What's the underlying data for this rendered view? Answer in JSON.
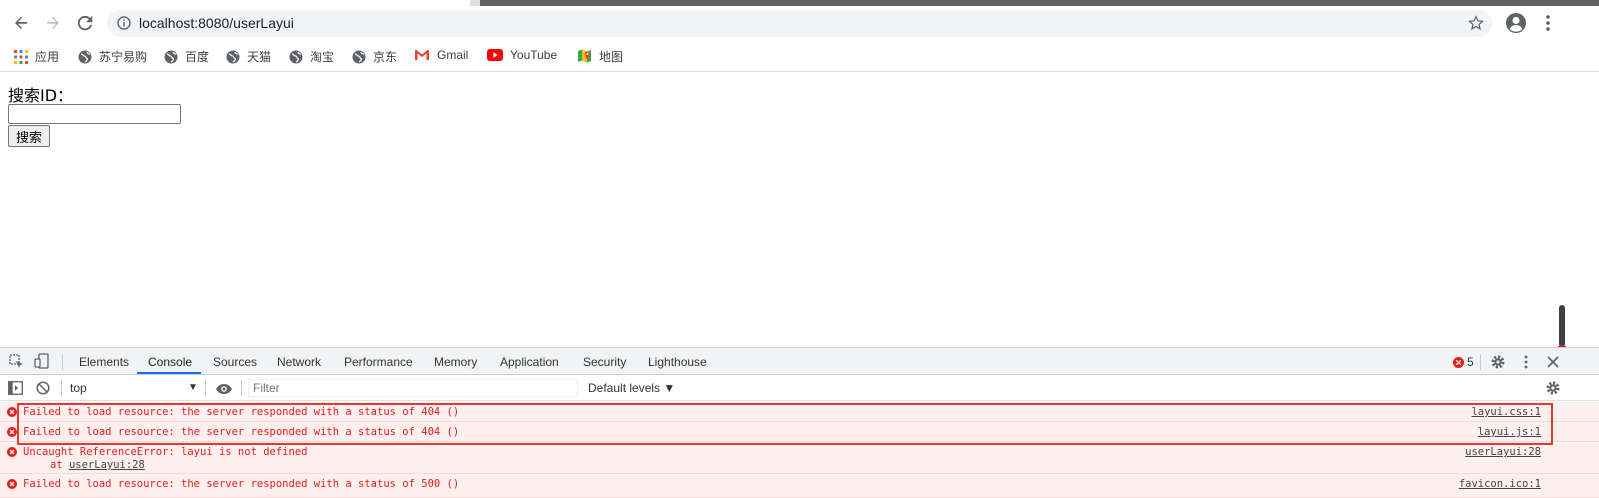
{
  "browser": {
    "url": "localhost:8080/userLayui",
    "bookmarks": [
      {
        "label": "应用",
        "icon": "apps-grid-icon"
      },
      {
        "label": "苏宁易购",
        "icon": "globe-icon"
      },
      {
        "label": "百度",
        "icon": "globe-icon"
      },
      {
        "label": "天猫",
        "icon": "globe-icon"
      },
      {
        "label": "淘宝",
        "icon": "globe-icon"
      },
      {
        "label": "京东",
        "icon": "globe-icon"
      },
      {
        "label": "Gmail",
        "icon": "gmail-icon"
      },
      {
        "label": "YouTube",
        "icon": "youtube-icon"
      },
      {
        "label": "地图",
        "icon": "maps-icon"
      }
    ]
  },
  "page": {
    "search_label": "搜索ID：",
    "search_value": "",
    "search_button": "搜索"
  },
  "devtools": {
    "tabs": [
      "Elements",
      "Console",
      "Sources",
      "Network",
      "Performance",
      "Memory",
      "Application",
      "Security",
      "Lighthouse"
    ],
    "active_tab": "Console",
    "error_count": "5",
    "context": "top",
    "filter_placeholder": "Filter",
    "levels": "Default levels ▼",
    "messages": [
      {
        "text": "Failed to load resource: the server responded with a status of 404 ()",
        "source": "layui.css:1"
      },
      {
        "text": "Failed to load resource: the server responded with a status of 404 ()",
        "source": "layui.js:1"
      },
      {
        "text": "Uncaught ReferenceError: layui is not defined",
        "source": "userLayui:28",
        "stack_prefix": "at ",
        "stack_link": "userLayui:28"
      },
      {
        "text": "Failed to load resource: the server responded with a status of 500 ()",
        "source": "favicon.ico:1"
      }
    ]
  },
  "colors": {
    "error_red": "#e51d1d",
    "error_bg": "#fff0f0",
    "devtools_accent": "#1a73e8",
    "highlight": "#e53935"
  }
}
